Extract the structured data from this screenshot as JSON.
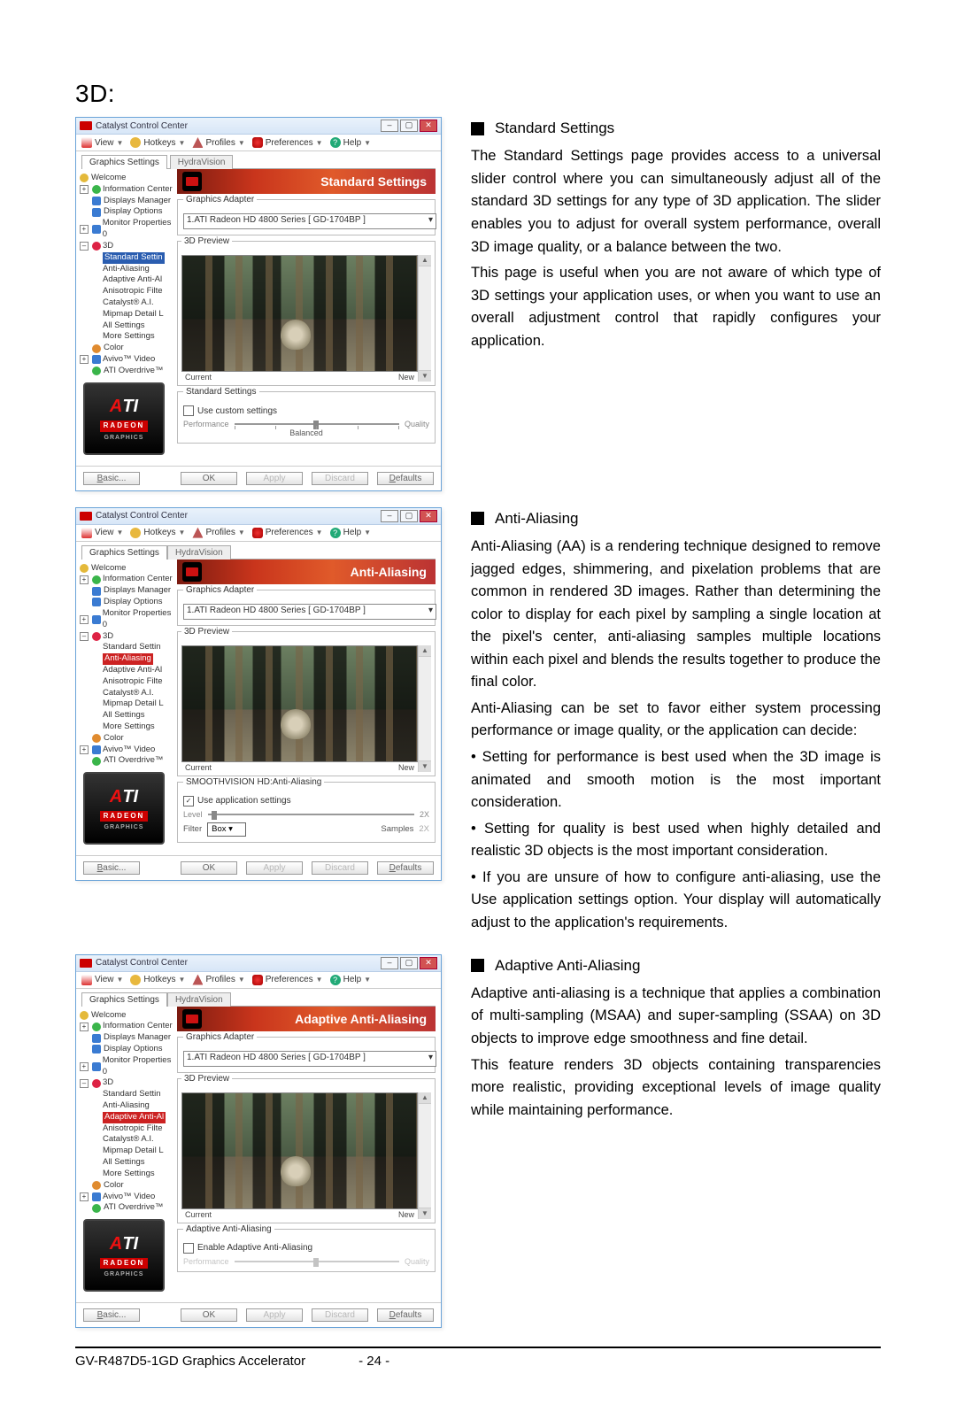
{
  "page": {
    "title": "3D:",
    "footer_product": "GV-R487D5-1GD Graphics Accelerator",
    "footer_page": "- 24 -"
  },
  "sections": {
    "s1": {
      "heading": "Standard Settings",
      "p1": "The Standard Settings page provides access to a universal slider control where you can simultaneously adjust all of the standard 3D settings for any type of 3D application. The slider enables you to adjust for overall system performance, overall 3D image quality, or a balance between the two.",
      "p2": "This page is useful when you are not aware of which type of 3D settings your application uses, or when you want to use an overall adjustment control that rapidly configures your application."
    },
    "s2": {
      "heading": "Anti-Aliasing",
      "p1": "Anti-Aliasing (AA) is a rendering technique designed to remove jagged edges, shimmering, and pixelation problems that are common in rendered 3D images. Rather than determining the color to display for each pixel by sampling a single location at the pixel's center, anti-aliasing samples multiple locations within each pixel and blends the results together to produce the final color.",
      "p2": "Anti-Aliasing can be set to favor either system processing performance or image quality, or the application can decide:",
      "b1": "• Setting for performance is best used when the 3D image is animated and smooth motion is the most important consideration.",
      "b2": "• Setting for quality is best used when highly detailed and realistic 3D objects is the most important consideration.",
      "b3": "• If you are unsure of how to configure anti-aliasing, use the Use application settings option. Your display will automatically adjust to the application's requirements."
    },
    "s3": {
      "heading": "Adaptive Anti-Aliasing",
      "p1": "Adaptive anti-aliasing is a technique that applies a combination of multi-sampling (MSAA) and super-sampling (SSAA) on 3D objects to improve edge smoothness and fine detail.",
      "p2": "This feature renders 3D objects containing transparencies more realistic, providing exceptional levels of image quality while maintaining performance."
    }
  },
  "ccc": {
    "title": "Catalyst Control Center",
    "menus": {
      "view": "View",
      "hotkeys": "Hotkeys",
      "profiles": "Profiles",
      "preferences": "Preferences",
      "help": "Help"
    },
    "tabs": {
      "gs": "Graphics Settings",
      "hv": "HydraVision"
    },
    "tree": {
      "welcome": "Welcome",
      "info": "Information Center",
      "disp_mgr": "Displays Manager",
      "disp_opt": "Display Options",
      "mon_props": "Monitor Properties 0",
      "threeD": "3D",
      "std": "Standard Settin",
      "aa": "Anti-Aliasing",
      "aaa": "Adaptive Anti-Al",
      "aniso": "Anisotropic Filte",
      "cat_ai": "Catalyst® A.I.",
      "mip": "Mipmap Detail L",
      "all": "All Settings",
      "more": "More Settings",
      "color": "Color",
      "avivo": "Avivo™ Video",
      "overdrive": "ATI Overdrive™"
    },
    "adapter_label": "Graphics Adapter",
    "adapter_value": "1.ATI Radeon HD 4800 Series [ GD-1704BP ]",
    "preview_label": "3D Preview",
    "prev_current": "Current",
    "prev_new": "New",
    "std_group": "Standard Settings",
    "std_check": "Use custom settings",
    "slider_left": "Performance",
    "slider_right": "Quality",
    "balanced": "Balanced",
    "aa_group": "SMOOTHVISION HD:Anti-Aliasing",
    "aa_check": "Use application settings",
    "aa_level": "Level",
    "aa_2x": "2X",
    "aa_filter": "Filter",
    "aa_box": "Box",
    "aa_samples": "Samples",
    "aa_sval": "2X",
    "aaa_group": "Adaptive Anti-Aliasing",
    "aaa_check": "Enable Adaptive Anti-Aliasing",
    "buttons": {
      "basic": "Basic...",
      "ok": "OK",
      "apply": "Apply",
      "discard": "Discard",
      "defaults": "Defaults"
    },
    "hdr_std": "Standard Settings",
    "hdr_aa": "Anti-Aliasing",
    "hdr_aaa": "Adaptive Anti-Aliasing"
  }
}
